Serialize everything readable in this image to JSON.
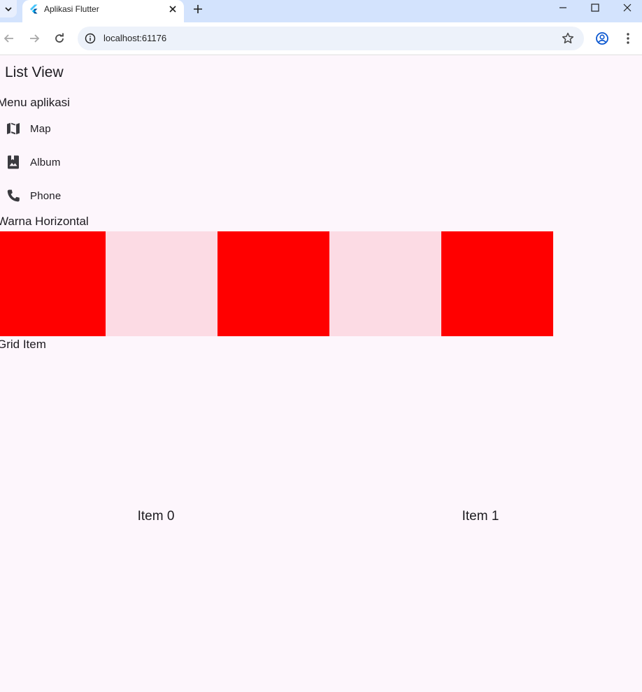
{
  "browser": {
    "tab_title": "Aplikasi Flutter",
    "url": "localhost:61176",
    "colors": {
      "tabbar": "#d3e3fd",
      "omnibox": "#edf2fa"
    }
  },
  "app": {
    "title": "List View",
    "menu_section": "Menu aplikasi",
    "menu_items": [
      {
        "label": "Map",
        "icon": "map-icon"
      },
      {
        "label": "Album",
        "icon": "photo-album-icon"
      },
      {
        "label": "Phone",
        "icon": "phone-icon"
      }
    ],
    "color_section": "Warna Horizontal",
    "color_boxes": [
      "#ff0000",
      "#fcdbe4",
      "#ff0000",
      "#fcdbe4",
      "#ff0000"
    ],
    "grid_section": "Grid Item",
    "grid_items": [
      {
        "label": "Item 0"
      },
      {
        "label": "Item 1"
      }
    ],
    "colors": {
      "background": "#fdf6fc",
      "text": "#1d1b20"
    }
  }
}
